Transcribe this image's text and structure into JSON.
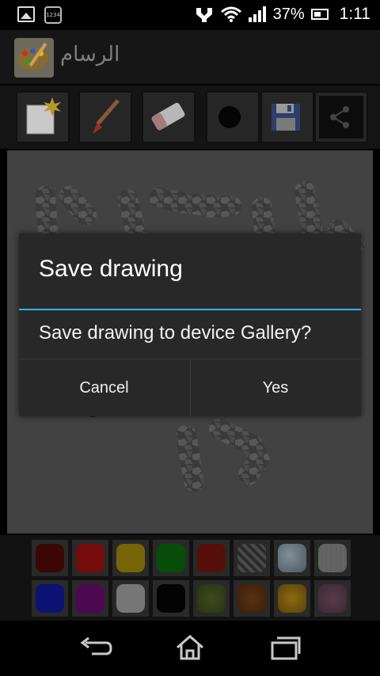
{
  "status_bar": {
    "battery_percent": "37%",
    "time": "1:11",
    "notification_icons": [
      "image-icon",
      "numbers-app-icon"
    ],
    "system_icons": [
      "usb-debug-icon",
      "wifi-icon",
      "signal-icon",
      "battery-icon"
    ]
  },
  "app": {
    "title": "الرسام",
    "icon": "paint-palette-icon"
  },
  "toolbar": {
    "tools": [
      "new-canvas-icon",
      "brush-icon",
      "eraser-icon",
      "brush-size-icon",
      "save-icon",
      "share-icon"
    ]
  },
  "palette": {
    "swatches": [
      "#6b0a0a",
      "#d41414",
      "#d8b60d",
      "#0f8a12",
      "#9e1c14",
      "texture-stone",
      "texture-ice",
      "texture-mosaic",
      "#1622d0",
      "#8a1092",
      "#d6d6d6",
      "#050505",
      "texture-moss",
      "texture-bark",
      "texture-gold",
      "texture-floral"
    ]
  },
  "dialog": {
    "title": "Save drawing",
    "message": "Save drawing to device Gallery?",
    "cancel_label": "Cancel",
    "yes_label": "Yes",
    "divider_color": "#33b5e5"
  },
  "nav_bar": {
    "buttons": [
      "back-icon",
      "home-icon",
      "recent-apps-icon"
    ]
  }
}
